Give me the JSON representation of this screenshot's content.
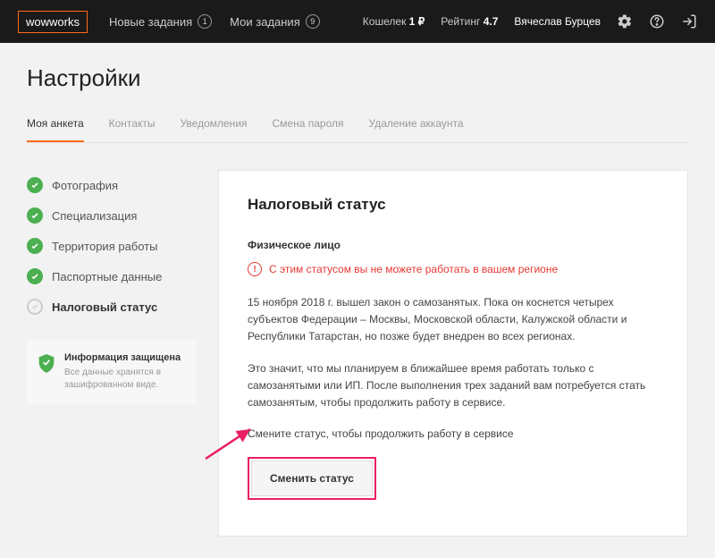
{
  "topbar": {
    "logo": "wowworks",
    "nav": [
      {
        "label": "Новые задания",
        "count": "1"
      },
      {
        "label": "Мои задания",
        "count": "9"
      }
    ],
    "wallet_label": "Кошелек",
    "wallet_value": "1 ₽",
    "rating_label": "Рейтинг",
    "rating_value": "4.7",
    "username": "Вячеслав Бурцев"
  },
  "page": {
    "title": "Настройки",
    "tabs": [
      "Моя анкета",
      "Контакты",
      "Уведомления",
      "Смена пароля",
      "Удаление аккаунта"
    ]
  },
  "sidebar": {
    "steps": [
      {
        "label": "Фотография",
        "done": true
      },
      {
        "label": "Специализация",
        "done": true
      },
      {
        "label": "Территория работы",
        "done": true
      },
      {
        "label": "Паспортные данные",
        "done": true
      },
      {
        "label": "Налоговый статус",
        "done": false,
        "active": true
      }
    ],
    "info_title": "Информация защищена",
    "info_text": "Все данные хранятся в зашифрованном виде."
  },
  "panel": {
    "title": "Налоговый статус",
    "subtitle": "Физическое лицо",
    "warning": "С этим статусом вы не можете работать в вашем регионе",
    "p1": "15 ноября 2018 г. вышел закон о самозанятых. Пока он коснется четырех субъектов Федерации – Москвы, Московской области, Калужской области и Республики Татарстан, но позже будет внедрен во всех регионах.",
    "p2": "Это значит, что мы планируем в ближайшее время работать только с самозанятыми или ИП. После выполнения трех заданий вам потребуется стать самозанятым, чтобы продолжить работу в сервисе.",
    "p3": "Смените статус, чтобы продолжить работу в сервисе",
    "button": "Сменить статус"
  }
}
